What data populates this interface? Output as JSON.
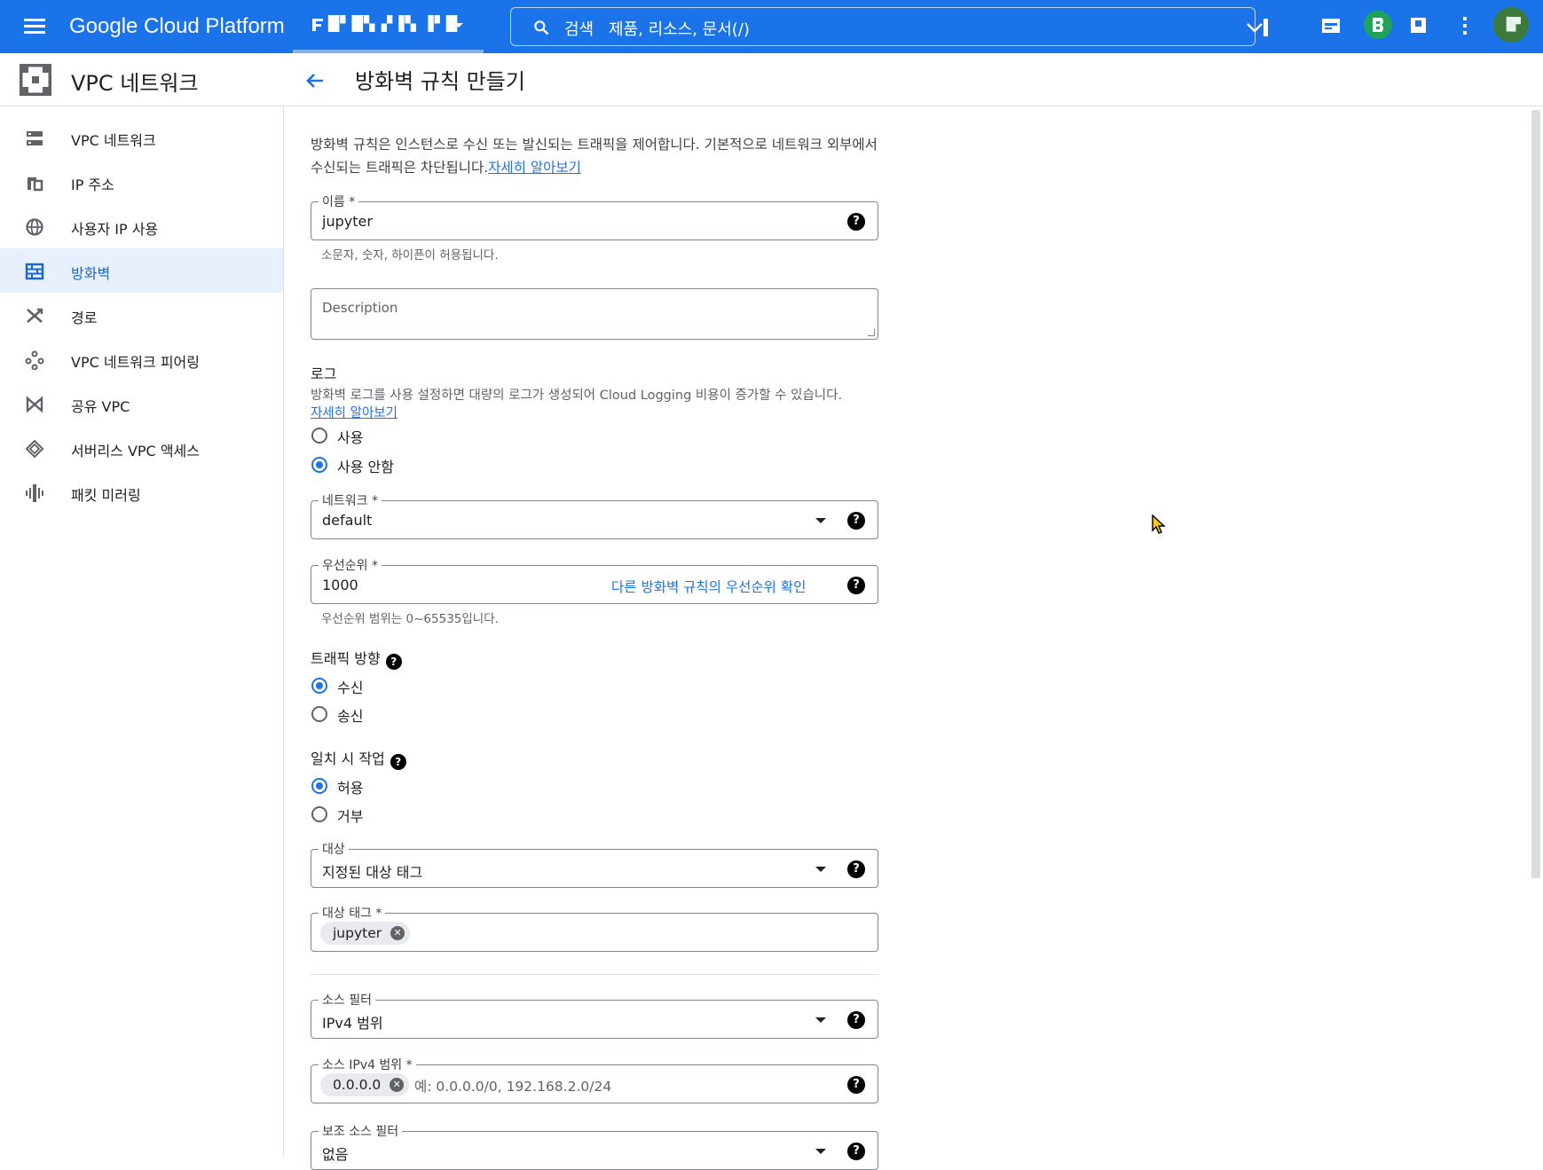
{
  "topbar": {
    "brand": "Google Cloud Platform",
    "project": "█▘█▚ ▞▐▚ ▐▘█",
    "search_label": "검색",
    "search_placeholder": "제품, 리소스, 문서(/)",
    "avatar_text": "▐▛"
  },
  "sidebar": {
    "title": "VPC 네트워크",
    "items": [
      {
        "label": "VPC 네트워크",
        "icon": "vpc-network-icon"
      },
      {
        "label": "IP 주소",
        "icon": "ip-address-icon"
      },
      {
        "label": "사용자 IP 사용",
        "icon": "globe-icon"
      },
      {
        "label": "방화벽",
        "icon": "firewall-icon",
        "active": true
      },
      {
        "label": "경로",
        "icon": "routes-icon"
      },
      {
        "label": "VPC 네트워크 피어링",
        "icon": "peering-icon"
      },
      {
        "label": "공유 VPC",
        "icon": "shared-vpc-icon"
      },
      {
        "label": "서버리스 VPC 액세스",
        "icon": "serverless-icon"
      },
      {
        "label": "패킷 미러링",
        "icon": "packet-mirroring-icon"
      }
    ]
  },
  "header": {
    "title": "방화벽 규칙 만들기"
  },
  "form": {
    "intro": "방화벽 규칙은 인스턴스로 수신 또는 발신되는 트래픽을 제어합니다. 기본적으로 네트워크 외부에서 수신되는 트래픽은 차단됩니다.",
    "learn_more": "자세히 알아보기",
    "name": {
      "label": "이름 *",
      "value": "jupyter",
      "hint": "소문자, 숫자, 하이픈이 허용됩니다."
    },
    "description": {
      "placeholder": "Description"
    },
    "logs": {
      "title": "로그",
      "desc": "방화벽 로그를 사용 설정하면 대량의 로그가 생성되어 Cloud Logging 비용이 증가할 수 있습니다.",
      "learn_more": "자세히 알아보기",
      "options": [
        "사용",
        "사용 안함"
      ],
      "selected": 1
    },
    "network": {
      "label": "네트워크 *",
      "value": "default"
    },
    "priority": {
      "label": "우선순위 *",
      "value": "1000",
      "link": "다른 방화벽 규칙의 우선순위 확인",
      "hint": "우선순위 범위는 0~65535입니다."
    },
    "direction": {
      "title": "트래픽 방향",
      "options": [
        "수신",
        "송신"
      ],
      "selected": 0
    },
    "action": {
      "title": "일치 시 작업",
      "options": [
        "허용",
        "거부"
      ],
      "selected": 0
    },
    "targets": {
      "label": "대상",
      "value": "지정된 대상 태그"
    },
    "target_tags": {
      "label": "대상 태그 *",
      "chip": "jupyter"
    },
    "source_filter": {
      "label": "소스 필터",
      "value": "IPv4 범위"
    },
    "source_ranges": {
      "label": "소스 IPv4 범위 *",
      "chip": "0.0.0.0",
      "placeholder": "예: 0.0.0.0/0, 192.168.2.0/24"
    },
    "second_filter": {
      "label": "보조 소스 필터",
      "value": "없음"
    }
  }
}
